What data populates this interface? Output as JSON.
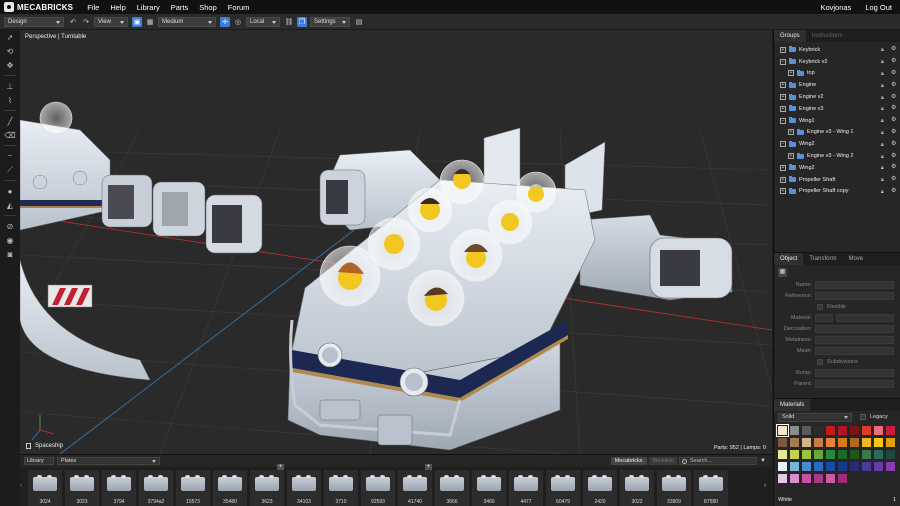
{
  "app": {
    "logo_text": "MECABRICKS",
    "menu": [
      "File",
      "Help",
      "Library",
      "Parts",
      "Shop",
      "Forum"
    ],
    "user": "Kovjonas",
    "logout": "Log Out"
  },
  "toolbar": {
    "mode": "Design",
    "view": "View",
    "quality": "Medium",
    "space": "Local",
    "settings": "Settings"
  },
  "viewport": {
    "label": "Perspective | Turntable",
    "scene_name": "Spaceship",
    "stats": "Parts: 952 | Lamps: 0"
  },
  "groups_panel": {
    "tabs": [
      "Groups",
      "Instructions"
    ],
    "items": [
      {
        "label": "Keybrick",
        "indent": 0,
        "exp": "+"
      },
      {
        "label": "Keybrick v2",
        "indent": 0,
        "exp": "−"
      },
      {
        "label": "top",
        "indent": 1,
        "exp": "+"
      },
      {
        "label": "Engine",
        "indent": 0,
        "exp": "+"
      },
      {
        "label": "Engine v2",
        "indent": 0,
        "exp": "+"
      },
      {
        "label": "Engine v3",
        "indent": 0,
        "exp": "+"
      },
      {
        "label": "Wing1",
        "indent": 0,
        "exp": "−"
      },
      {
        "label": "Engine v3 - Wing 1",
        "indent": 1,
        "exp": "+"
      },
      {
        "label": "Wing2",
        "indent": 0,
        "exp": "−"
      },
      {
        "label": "Engine v3 - Wing 2",
        "indent": 1,
        "exp": "+"
      },
      {
        "label": "Wing2",
        "indent": 0,
        "exp": "+"
      },
      {
        "label": "Propeller Shaft",
        "indent": 0,
        "exp": "+"
      },
      {
        "label": "Propeller Shaft copy",
        "indent": 0,
        "exp": "+"
      }
    ]
  },
  "object_panel": {
    "tabs": [
      "Object",
      "Transform",
      "Move"
    ],
    "fields": {
      "name": "Name:",
      "reference": "Reference:",
      "flexible": "Flexible",
      "material": "Material:",
      "decoration": "Decoration:",
      "metalness": "Metalness:",
      "mesh": "Mesh:",
      "subdivisions": "Subdivisions",
      "bump": "Bump:",
      "parent": "Parent:"
    }
  },
  "materials_panel": {
    "title": "Materials",
    "type": "Solid",
    "legacy": "Legacy",
    "selected_name": "White",
    "selected_id": "1",
    "swatches": [
      "#f4e7c2",
      "#8b8b8b",
      "#5a5a5a",
      "#2b2b2b",
      "#c41a1a",
      "#b31428",
      "#7a1616",
      "#e23a2a",
      "#ef6a7a",
      "#c8203a",
      "#7a5a3a",
      "#a57a52",
      "#d6b38a",
      "#c87a4a",
      "#e8823a",
      "#d67a1a",
      "#b06a1a",
      "#f0b820",
      "#f5c518",
      "#e0a010",
      "#e8e890",
      "#c8d050",
      "#9ac43a",
      "#6aa83a",
      "#2a8a3a",
      "#1a6a2a",
      "#1a5a1a",
      "#3a7a4a",
      "#2a6a5a",
      "#1a4a3a",
      "#e8f0f8",
      "#78b4d8",
      "#4a8ad0",
      "#2a6ac0",
      "#1a4aa8",
      "#1a3a88",
      "#2a2a78",
      "#4a3aa0",
      "#6a3aa8",
      "#8a3ab0",
      "#e8c8e8",
      "#d890c8",
      "#c850a8",
      "#a83a8a",
      "#d05aa0",
      "#a02a7a"
    ]
  },
  "parts_bar": {
    "library": "Library",
    "category": "Plates",
    "sources": [
      "Mecabricks",
      "Bricklink"
    ],
    "search_placeholder": "Search...",
    "parts": [
      {
        "num": "3024",
        "plus": false
      },
      {
        "num": "3023",
        "plus": false
      },
      {
        "num": "3794",
        "plus": false
      },
      {
        "num": "3794a2",
        "plus": false
      },
      {
        "num": "15573",
        "plus": false
      },
      {
        "num": "35480",
        "plus": false
      },
      {
        "num": "3623",
        "plus": true
      },
      {
        "num": "34103",
        "plus": false
      },
      {
        "num": "3710",
        "plus": false
      },
      {
        "num": "92593",
        "plus": false
      },
      {
        "num": "41740",
        "plus": true
      },
      {
        "num": "3666",
        "plus": false
      },
      {
        "num": "3460",
        "plus": false
      },
      {
        "num": "4477",
        "plus": false
      },
      {
        "num": "60479",
        "plus": false
      },
      {
        "num": "2420",
        "plus": false
      },
      {
        "num": "3022",
        "plus": false
      },
      {
        "num": "33909",
        "plus": false
      },
      {
        "num": "87580",
        "plus": false
      }
    ]
  }
}
